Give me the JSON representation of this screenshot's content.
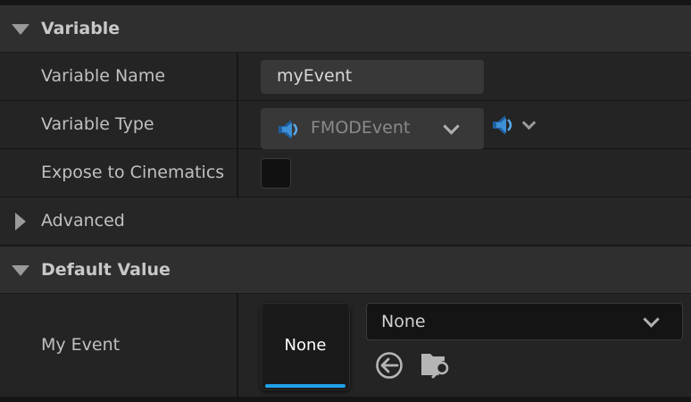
{
  "sections": {
    "variable": {
      "title": "Variable"
    },
    "default_value": {
      "title": "Default Value"
    }
  },
  "properties": {
    "variable_name": {
      "label": "Variable Name",
      "value": "myEvent"
    },
    "variable_type": {
      "label": "Variable Type",
      "value": "FMODEvent",
      "icon": "fmod-speaker-icon"
    },
    "expose_to_cinematics": {
      "label": "Expose to Cinematics",
      "checked": false
    },
    "advanced": {
      "label": "Advanced",
      "expanded": false
    },
    "my_event": {
      "label": "My Event",
      "thumbnail_text": "None",
      "selected_asset": "None",
      "accent_color": "#20a0e8"
    }
  },
  "icons": {
    "use_selected": "arrow-left-circle-icon",
    "browse": "folder-search-icon"
  }
}
